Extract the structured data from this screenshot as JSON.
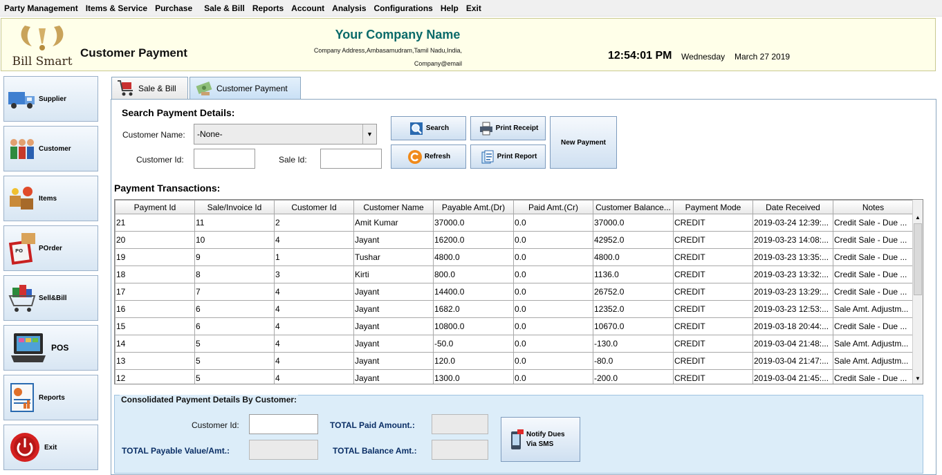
{
  "menu": [
    "Party Management",
    "Items & Service",
    "Purchase",
    "Sale & Bill",
    "Reports",
    "Account",
    "Analysis",
    "Configurations",
    "Help",
    "Exit"
  ],
  "header": {
    "logo_text": "Bill Smart",
    "page_title": "Customer Payment",
    "company_name": "Your Company Name",
    "company_address": "Company Address,Ambasamudram,Tamil Nadu,India,",
    "company_email": "Company@email",
    "time": "12:54:01 PM",
    "day": "Wednesday",
    "date": "March 27 2019"
  },
  "sidebar": [
    {
      "label": "Supplier",
      "icon": "truck-icon"
    },
    {
      "label": "Customer",
      "icon": "people-icon"
    },
    {
      "label": "Items",
      "icon": "boxes-icon"
    },
    {
      "label": "POrder",
      "icon": "clipboard-icon"
    },
    {
      "label": "Sell&Bill",
      "icon": "shopping-cart-icon"
    },
    {
      "label": "POS",
      "icon": "pos-terminal-icon"
    },
    {
      "label": "Reports",
      "icon": "report-chart-icon"
    },
    {
      "label": "Exit",
      "icon": "power-icon"
    }
  ],
  "tabs": [
    {
      "label": "Sale & Bill",
      "icon": "cart-icon"
    },
    {
      "label": "Customer Payment",
      "icon": "money-icon"
    }
  ],
  "search": {
    "heading": "Search Payment Details:",
    "customer_name_label": "Customer Name:",
    "customer_name_value": "-None-",
    "customer_id_label": "Customer Id:",
    "sale_id_label": "Sale Id:",
    "search_button": "Search",
    "refresh_button": "Refresh",
    "print_receipt_button": "Print Receipt",
    "print_report_button": "Print Report",
    "new_payment_button": "New Payment"
  },
  "transactions": {
    "heading": "Payment Transactions:",
    "columns": [
      "Payment Id",
      "Sale/Invoice Id",
      "Customer Id",
      "Customer Name",
      "Payable Amt.(Dr)",
      "Paid Amt.(Cr)",
      "Customer Balance...",
      "Payment Mode",
      "Date Received",
      "Notes"
    ],
    "rows": [
      [
        "21",
        "11",
        "2",
        "Amit Kumar",
        "37000.0",
        "0.0",
        "37000.0",
        "CREDIT",
        "2019-03-24 12:39:...",
        "Credit Sale - Due ..."
      ],
      [
        "20",
        "10",
        "4",
        "Jayant",
        "16200.0",
        "0.0",
        "42952.0",
        "CREDIT",
        "2019-03-23 14:08:...",
        "Credit Sale - Due ..."
      ],
      [
        "19",
        "9",
        "1",
        "Tushar",
        "4800.0",
        "0.0",
        "4800.0",
        "CREDIT",
        "2019-03-23 13:35:...",
        "Credit Sale - Due ..."
      ],
      [
        "18",
        "8",
        "3",
        "Kirti",
        "800.0",
        "0.0",
        "1136.0",
        "CREDIT",
        "2019-03-23 13:32:...",
        "Credit Sale - Due ..."
      ],
      [
        "17",
        "7",
        "4",
        "Jayant",
        "14400.0",
        "0.0",
        "26752.0",
        "CREDIT",
        "2019-03-23 13:29:...",
        "Credit Sale - Due ..."
      ],
      [
        "16",
        "6",
        "4",
        "Jayant",
        "1682.0",
        "0.0",
        "12352.0",
        "CREDIT",
        "2019-03-23 12:53:...",
        "Sale Amt. Adjustm..."
      ],
      [
        "15",
        "6",
        "4",
        "Jayant",
        "10800.0",
        "0.0",
        "10670.0",
        "CREDIT",
        "2019-03-18 20:44:...",
        "Credit Sale - Due ..."
      ],
      [
        "14",
        "5",
        "4",
        "Jayant",
        "-50.0",
        "0.0",
        "-130.0",
        "CREDIT",
        "2019-03-04 21:48:...",
        "Sale Amt. Adjustm..."
      ],
      [
        "13",
        "5",
        "4",
        "Jayant",
        "120.0",
        "0.0",
        "-80.0",
        "CREDIT",
        "2019-03-04 21:47:...",
        "Sale Amt. Adjustm..."
      ],
      [
        "12",
        "5",
        "4",
        "Jayant",
        "1300.0",
        "0.0",
        "-200.0",
        "CREDIT",
        "2019-03-04 21:45:...",
        "Credit Sale - Due ..."
      ]
    ]
  },
  "consolidated": {
    "title": "Consolidated Payment Details By Customer:",
    "customer_id_label": "Customer Id:",
    "total_paid_label": "TOTAL Paid Amount.:",
    "total_payable_label": "TOTAL Payable Value/Amt.:",
    "total_balance_label": "TOTAL Balance Amt.:",
    "notify_button_line1": "Notify Dues",
    "notify_button_line2": "Via SMS"
  },
  "colors": {
    "header_bg": "#ffffe9",
    "company_name": "#0a6a6a",
    "panel_blue": "#dcedf9",
    "label_navy": "#0b2f66"
  }
}
